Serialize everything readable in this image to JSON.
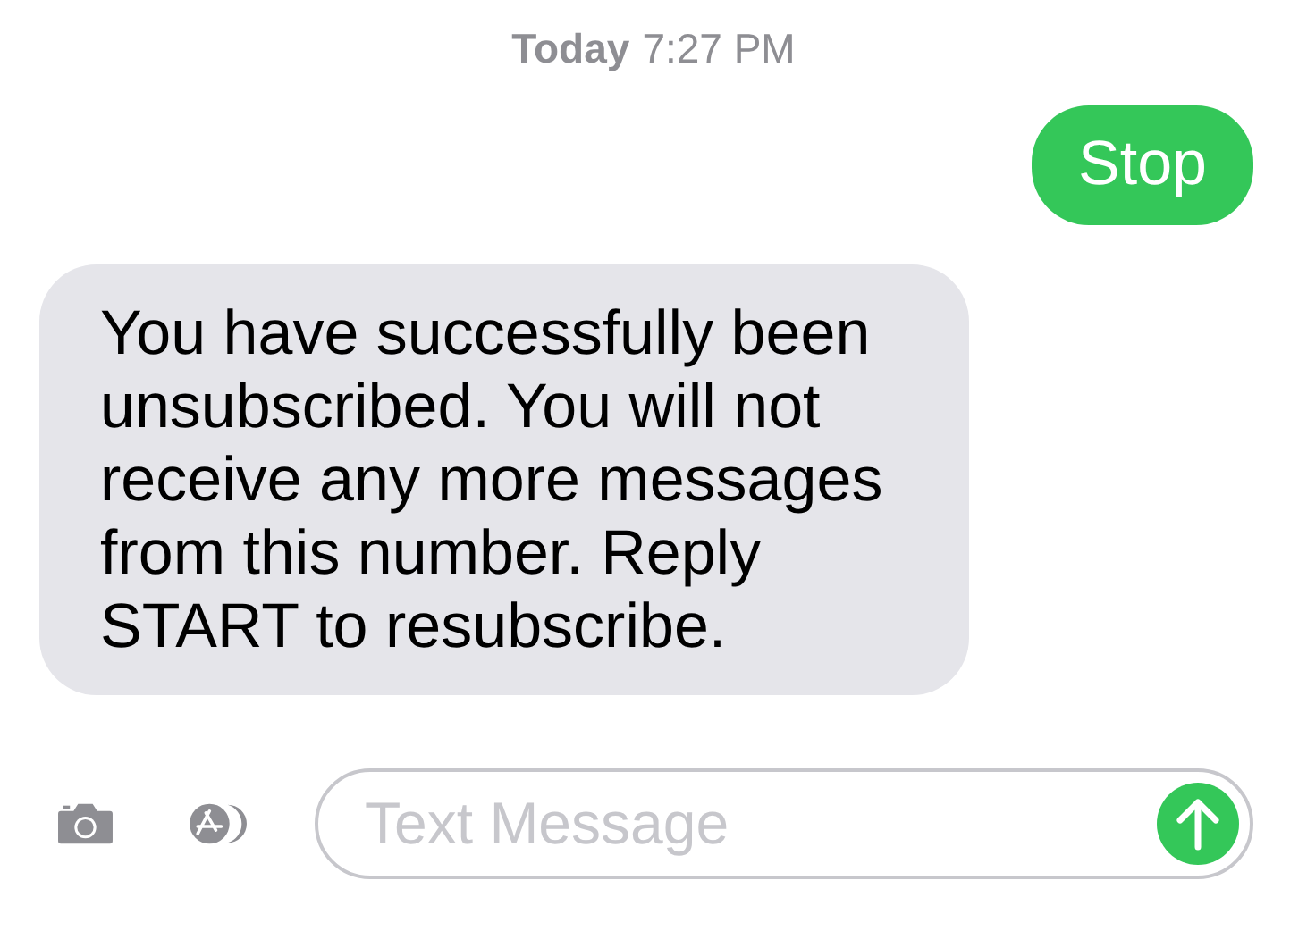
{
  "timestamp": {
    "day": "Today",
    "time": "7:27 PM"
  },
  "messages": [
    {
      "kind": "sent",
      "text": "Stop"
    },
    {
      "kind": "received",
      "text": "You have successfully been unsubscribed. You will not receive any more messages from this number. Reply START to resubscribe."
    }
  ],
  "composer": {
    "placeholder": "Text Message"
  }
}
